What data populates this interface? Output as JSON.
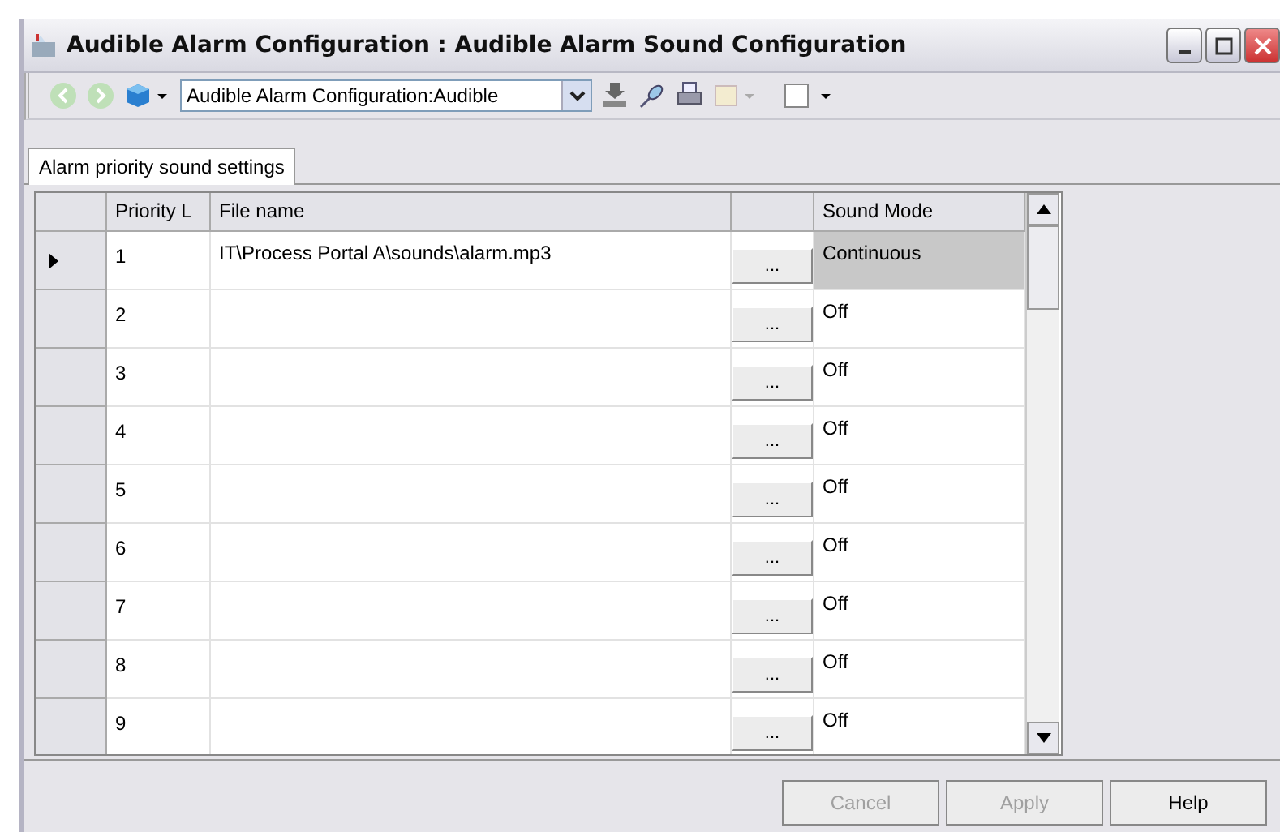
{
  "window": {
    "title": "Audible Alarm Configuration : Audible Alarm Sound Configuration"
  },
  "toolbar": {
    "location": "Audible Alarm Configuration:Audible"
  },
  "tabs": [
    {
      "label": "Alarm priority sound settings",
      "selected": true
    }
  ],
  "table": {
    "columns": [
      "Priority L",
      "File name",
      "Sound Mode"
    ],
    "rows": [
      {
        "priority": "1",
        "file_name": "IT\\Process Portal A\\sounds\\alarm.mp3",
        "browse": "...",
        "sound_mode": "Continuous",
        "selected": true
      },
      {
        "priority": "2",
        "file_name": "",
        "browse": "...",
        "sound_mode": "Off",
        "selected": false
      },
      {
        "priority": "3",
        "browse": "...",
        "sound_mode": "Off",
        "selected": false
      },
      {
        "priority": "4",
        "browse": "...",
        "sound_mode": "Off",
        "selected": false
      },
      {
        "priority": "5",
        "browse": "...",
        "sound_mode": "Off",
        "selected": false
      },
      {
        "priority": "6",
        "browse": "...",
        "sound_mode": "Off",
        "selected": false
      },
      {
        "priority": "7",
        "browse": "...",
        "sound_mode": "Off",
        "selected": false
      },
      {
        "priority": "8",
        "browse": "...",
        "sound_mode": "Off",
        "selected": false
      },
      {
        "priority": "9",
        "browse": "...",
        "sound_mode": "Off",
        "selected": false
      }
    ]
  },
  "buttons": [
    {
      "label": "Cancel",
      "disabled": true
    },
    {
      "label": "Apply",
      "disabled": true
    },
    {
      "label": "Help",
      "disabled": false
    }
  ]
}
